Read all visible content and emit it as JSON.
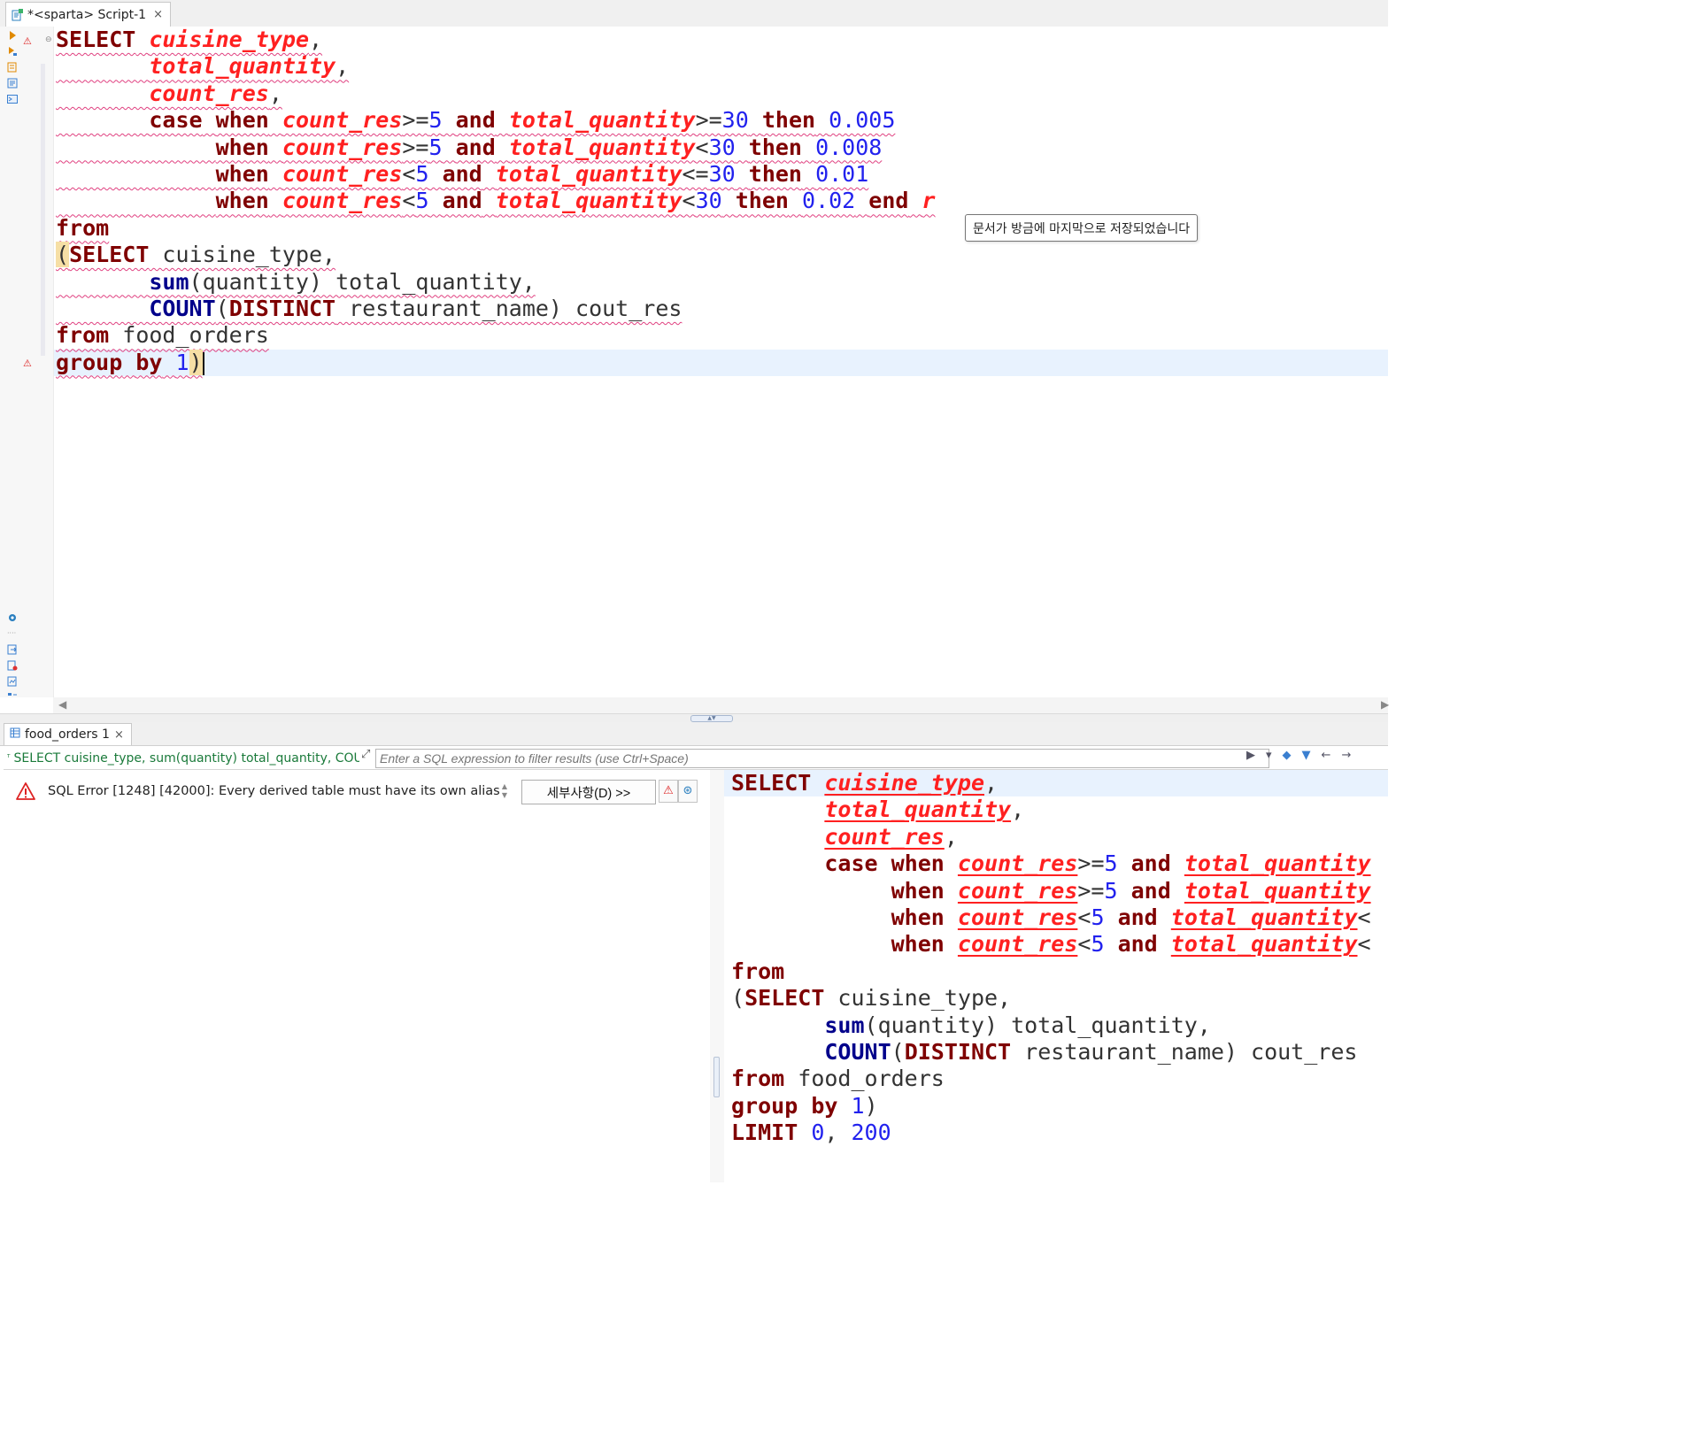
{
  "editor_tab": {
    "title": "*<sparta> Script-1",
    "close": "×"
  },
  "tooltip": "문서가 방금에 마지막으로 저장되었습니다",
  "results_tab": {
    "title": "food_orders 1",
    "close": "×"
  },
  "filter": {
    "query_snippet": "SELECT cuisine_type, sum(quantity) total_quantity, COUN",
    "placeholder": "Enter a SQL expression to filter results (use Ctrl+Space)"
  },
  "error": {
    "message": "SQL Error [1248] [42000]: Every derived table must have its own alias",
    "details_button": "세부사항(D) >>"
  },
  "script": [
    [
      [
        "kw",
        "SELECT"
      ],
      [
        "t",
        " "
      ],
      [
        "col",
        "cuisine_type"
      ],
      [
        "t",
        ","
      ]
    ],
    [
      [
        "t",
        "       "
      ],
      [
        "col",
        "total_quantity"
      ],
      [
        "t",
        ","
      ]
    ],
    [
      [
        "t",
        "       "
      ],
      [
        "col",
        "count_res"
      ],
      [
        "t",
        ","
      ]
    ],
    [
      [
        "t",
        "       "
      ],
      [
        "kw",
        "case"
      ],
      [
        "t",
        " "
      ],
      [
        "kw",
        "when"
      ],
      [
        "t",
        " "
      ],
      [
        "col",
        "count_res"
      ],
      [
        "t",
        ">="
      ],
      [
        "num",
        "5"
      ],
      [
        "t",
        " "
      ],
      [
        "kw",
        "and"
      ],
      [
        "t",
        " "
      ],
      [
        "col",
        "total_quantity"
      ],
      [
        "t",
        ">="
      ],
      [
        "num",
        "30"
      ],
      [
        "t",
        " "
      ],
      [
        "kw",
        "then"
      ],
      [
        "t",
        " "
      ],
      [
        "num",
        "0.005"
      ]
    ],
    [
      [
        "t",
        "            "
      ],
      [
        "kw",
        "when"
      ],
      [
        "t",
        " "
      ],
      [
        "col",
        "count_res"
      ],
      [
        "t",
        ">="
      ],
      [
        "num",
        "5"
      ],
      [
        "t",
        " "
      ],
      [
        "kw",
        "and"
      ],
      [
        "t",
        " "
      ],
      [
        "col",
        "total_quantity"
      ],
      [
        "t",
        "<"
      ],
      [
        "num",
        "30"
      ],
      [
        "t",
        " "
      ],
      [
        "kw",
        "then"
      ],
      [
        "t",
        " "
      ],
      [
        "num",
        "0.008"
      ]
    ],
    [
      [
        "t",
        "            "
      ],
      [
        "kw",
        "when"
      ],
      [
        "t",
        " "
      ],
      [
        "col",
        "count_res"
      ],
      [
        "t",
        "<"
      ],
      [
        "num",
        "5"
      ],
      [
        "t",
        " "
      ],
      [
        "kw",
        "and"
      ],
      [
        "t",
        " "
      ],
      [
        "col",
        "total_quantity"
      ],
      [
        "t",
        "<="
      ],
      [
        "num",
        "30"
      ],
      [
        "t",
        " "
      ],
      [
        "kw",
        "then"
      ],
      [
        "t",
        " "
      ],
      [
        "num",
        "0.01"
      ]
    ],
    [
      [
        "t",
        "            "
      ],
      [
        "kw",
        "when"
      ],
      [
        "t",
        " "
      ],
      [
        "col",
        "count_res"
      ],
      [
        "t",
        "<"
      ],
      [
        "num",
        "5"
      ],
      [
        "t",
        " "
      ],
      [
        "kw",
        "and"
      ],
      [
        "t",
        " "
      ],
      [
        "col",
        "total_quantity"
      ],
      [
        "t",
        "<"
      ],
      [
        "num",
        "30"
      ],
      [
        "t",
        " "
      ],
      [
        "kw",
        "then"
      ],
      [
        "t",
        " "
      ],
      [
        "num",
        "0.02"
      ],
      [
        "t",
        " "
      ],
      [
        "kw",
        "end"
      ],
      [
        "t",
        " "
      ],
      [
        "col",
        "r"
      ]
    ],
    [
      [
        "kw",
        "from"
      ]
    ],
    [
      [
        "hl",
        "("
      ],
      [
        "kw",
        "SELECT"
      ],
      [
        "t",
        " cuisine_type,"
      ]
    ],
    [
      [
        "t",
        "       "
      ],
      [
        "kwb",
        "sum"
      ],
      [
        "t",
        "(quantity) total_quantity,"
      ]
    ],
    [
      [
        "t",
        "       "
      ],
      [
        "kwb",
        "COUNT"
      ],
      [
        "t",
        "("
      ],
      [
        "kw",
        "DISTINCT"
      ],
      [
        "t",
        " restaurant_name) cout_res"
      ]
    ],
    [
      [
        "kw",
        "from"
      ],
      [
        "t",
        " food_orders"
      ]
    ],
    [
      [
        "kw",
        "group"
      ],
      [
        "t",
        " "
      ],
      [
        "kw",
        "by"
      ],
      [
        "t",
        " "
      ],
      [
        "num",
        "1"
      ],
      [
        "hl",
        ")"
      ]
    ]
  ],
  "query_text": [
    [
      [
        "kw",
        "SELECT"
      ],
      [
        "t",
        " "
      ],
      [
        "col",
        "cuisine_type"
      ],
      [
        "t",
        ","
      ]
    ],
    [
      [
        "t",
        "       "
      ],
      [
        "col",
        "total_quantity"
      ],
      [
        "t",
        ","
      ]
    ],
    [
      [
        "t",
        "       "
      ],
      [
        "col",
        "count_res"
      ],
      [
        "t",
        ","
      ]
    ],
    [
      [
        "t",
        "       "
      ],
      [
        "kw",
        "case"
      ],
      [
        "t",
        " "
      ],
      [
        "kw",
        "when"
      ],
      [
        "t",
        " "
      ],
      [
        "col",
        "count_res"
      ],
      [
        "t",
        ">="
      ],
      [
        "num",
        "5"
      ],
      [
        "t",
        " "
      ],
      [
        "kw",
        "and"
      ],
      [
        "t",
        " "
      ],
      [
        "col",
        "total_quantity"
      ]
    ],
    [
      [
        "t",
        "            "
      ],
      [
        "kw",
        "when"
      ],
      [
        "t",
        " "
      ],
      [
        "col",
        "count_res"
      ],
      [
        "t",
        ">="
      ],
      [
        "num",
        "5"
      ],
      [
        "t",
        " "
      ],
      [
        "kw",
        "and"
      ],
      [
        "t",
        " "
      ],
      [
        "col",
        "total_quantity"
      ]
    ],
    [
      [
        "t",
        "            "
      ],
      [
        "kw",
        "when"
      ],
      [
        "t",
        " "
      ],
      [
        "col",
        "count_res"
      ],
      [
        "t",
        "<"
      ],
      [
        "num",
        "5"
      ],
      [
        "t",
        " "
      ],
      [
        "kw",
        "and"
      ],
      [
        "t",
        " "
      ],
      [
        "col",
        "total_quantity"
      ],
      [
        "t",
        "<"
      ]
    ],
    [
      [
        "t",
        "            "
      ],
      [
        "kw",
        "when"
      ],
      [
        "t",
        " "
      ],
      [
        "col",
        "count_res"
      ],
      [
        "t",
        "<"
      ],
      [
        "num",
        "5"
      ],
      [
        "t",
        " "
      ],
      [
        "kw",
        "and"
      ],
      [
        "t",
        " "
      ],
      [
        "col",
        "total_quantity"
      ],
      [
        "t",
        "<"
      ]
    ],
    [
      [
        "kw",
        "from"
      ]
    ],
    [
      [
        "t",
        "("
      ],
      [
        "kw",
        "SELECT"
      ],
      [
        "t",
        " cuisine_type,"
      ]
    ],
    [
      [
        "t",
        "       "
      ],
      [
        "kwb",
        "sum"
      ],
      [
        "t",
        "(quantity) total_quantity,"
      ]
    ],
    [
      [
        "t",
        "       "
      ],
      [
        "kwb",
        "COUNT"
      ],
      [
        "t",
        "("
      ],
      [
        "kw",
        "DISTINCT"
      ],
      [
        "t",
        " restaurant_name) cout_res"
      ]
    ],
    [
      [
        "kw",
        "from"
      ],
      [
        "t",
        " food_orders"
      ]
    ],
    [
      [
        "kw",
        "group"
      ],
      [
        "t",
        " "
      ],
      [
        "kw",
        "by"
      ],
      [
        "t",
        " "
      ],
      [
        "num",
        "1"
      ],
      [
        "t",
        ")"
      ]
    ],
    [
      [
        "kw",
        "LIMIT"
      ],
      [
        "t",
        " "
      ],
      [
        "num",
        "0"
      ],
      [
        "t",
        ", "
      ],
      [
        "num",
        "200"
      ]
    ]
  ],
  "colors": {
    "keyword": "#7f0000",
    "function": "#00008b",
    "column": "#ff2020",
    "number": "#2222ee",
    "squiggle": "#e04080",
    "current_line": "#e8f2fe"
  },
  "icons": {
    "script_tab": "sql-script-icon",
    "results_tab": "table-grid-icon",
    "error": "warning-triangle-icon"
  }
}
